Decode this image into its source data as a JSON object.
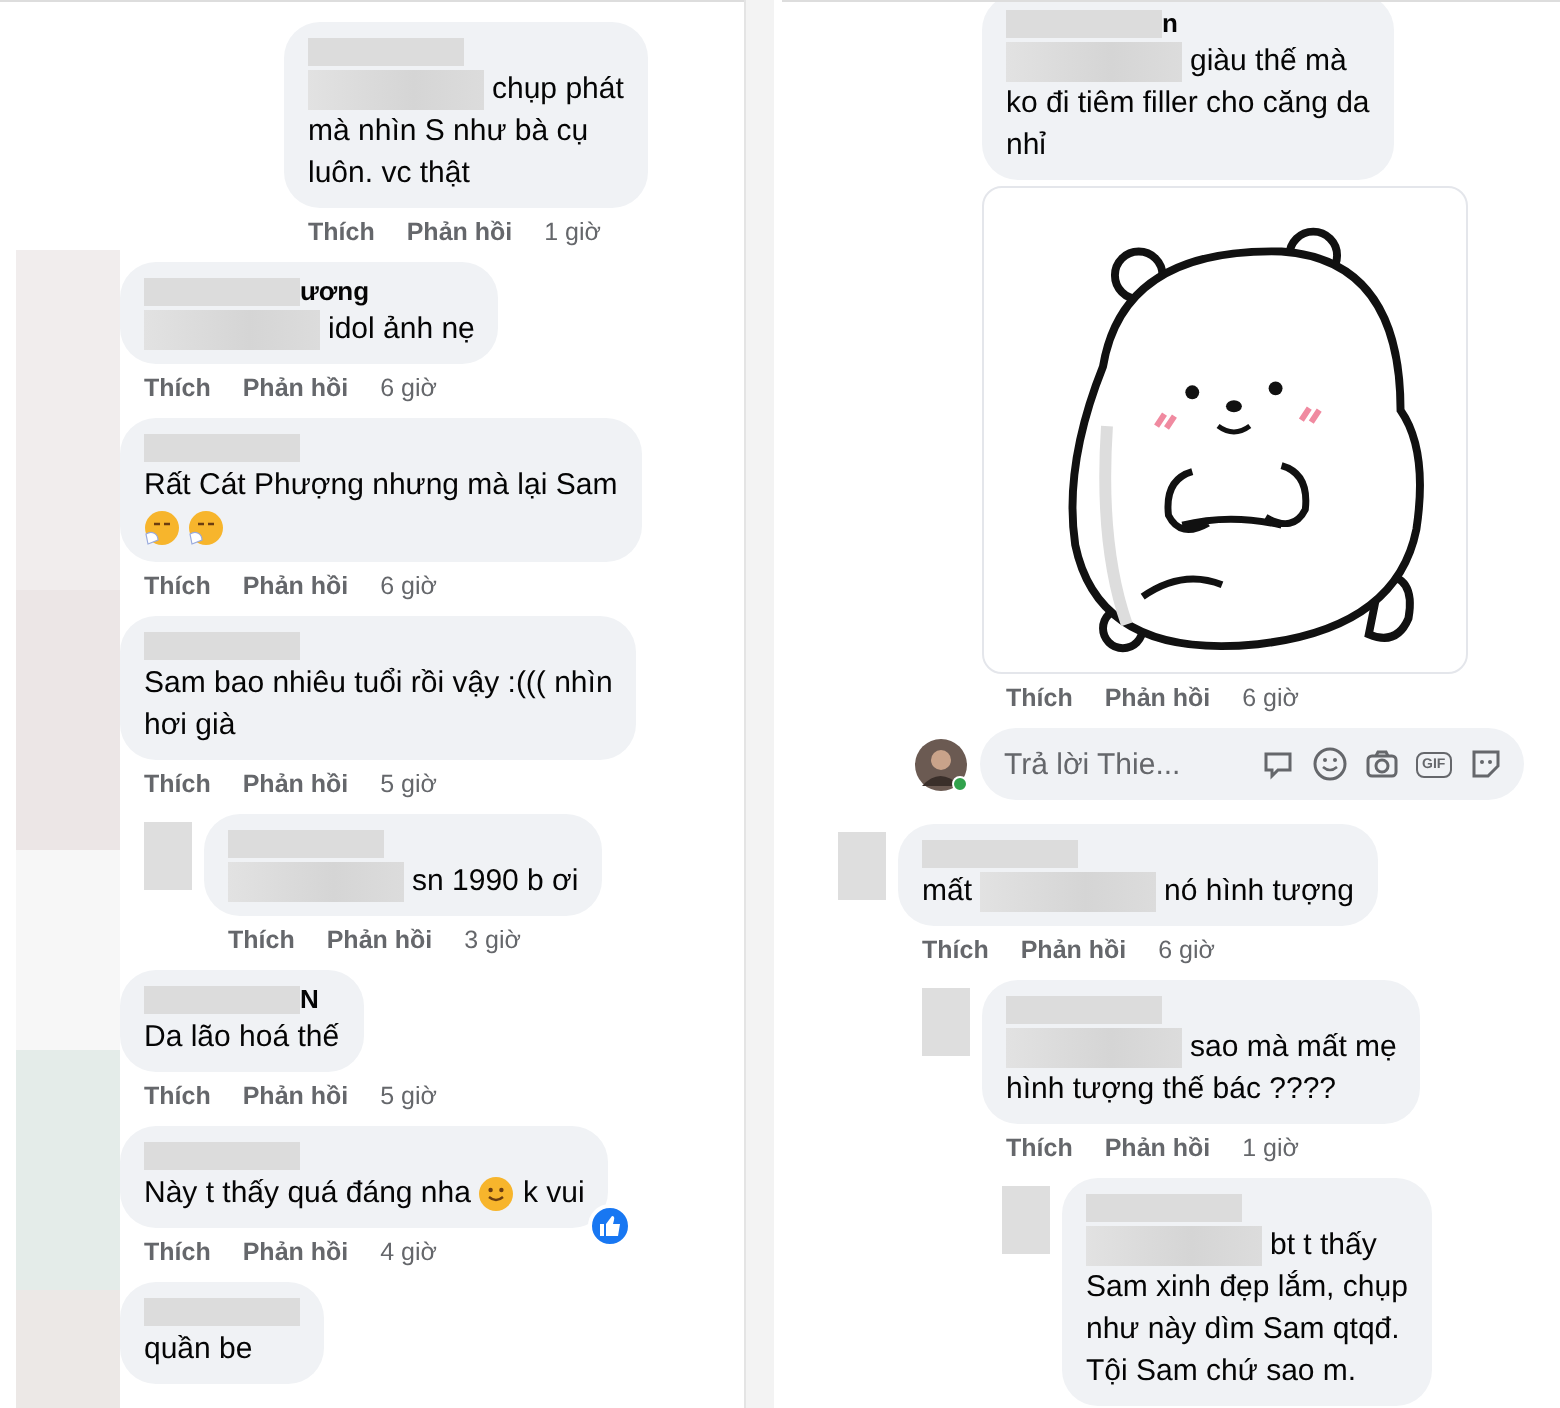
{
  "panels": [
    {
      "comments": [
        {
          "kind": "nested",
          "lines": [
            [
              {
                "kind": "redacted"
              },
              {
                "kind": "text",
                "text": "chụp phát"
              }
            ],
            [
              {
                "kind": "text",
                "text": "mà nhìn S như bà cụ"
              }
            ],
            [
              {
                "kind": "text",
                "text": "luôn. vc thật"
              }
            ]
          ],
          "actions": [
            "Thích",
            "Phản hồi",
            "1 giờ"
          ]
        },
        {
          "kind": "comment",
          "name": "ương",
          "lines": [
            [
              {
                "kind": "redacted"
              },
              {
                "kind": "text",
                "text": "idol ảnh nẹ"
              }
            ]
          ],
          "actions": [
            "Thích",
            "Phản hồi",
            "6 giờ"
          ]
        },
        {
          "kind": "comment",
          "lines": [
            [
              {
                "kind": "text",
                "text": "Rất Cát Phượng nhưng mà lại Sam"
              }
            ],
            [
              {
                "kind": "sneeze_emoji"
              },
              {
                "kind": "sneeze_emoji"
              }
            ]
          ],
          "actions": [
            "Thích",
            "Phản hồi",
            "6 giờ"
          ]
        },
        {
          "kind": "comment",
          "lines": [
            [
              {
                "kind": "text",
                "text": "Sam bao nhiêu tuổi rồi vậy :((( nhìn"
              }
            ],
            [
              {
                "kind": "text",
                "text": "hơi già"
              }
            ]
          ],
          "actions": [
            "Thích",
            "Phản hồi",
            "5 giờ"
          ]
        },
        {
          "kind": "reply",
          "avatar_redacted": true,
          "lines": [
            [
              {
                "kind": "redacted"
              },
              {
                "kind": "text",
                "text": "sn 1990 b ơi"
              }
            ]
          ],
          "actions": [
            "Thích",
            "Phản hồi",
            "3 giờ"
          ]
        },
        {
          "kind": "comment",
          "name": "N",
          "lines": [
            [
              {
                "kind": "text",
                "text": "Da lão hoá thế"
              }
            ]
          ],
          "actions": [
            "Thích",
            "Phản hồi",
            "5 giờ"
          ]
        },
        {
          "kind": "comment",
          "reaction": true,
          "lines": [
            [
              {
                "kind": "text",
                "text": "Này t thấy quá đáng nha"
              },
              {
                "kind": "smile_emoji"
              },
              {
                "kind": "text",
                "text": "k vui"
              }
            ]
          ],
          "actions": [
            "Thích",
            "Phản hồi",
            "4 giờ"
          ]
        },
        {
          "kind": "comment",
          "lines": [
            [
              {
                "kind": "text",
                "text": "quần be"
              }
            ]
          ]
        }
      ]
    },
    {
      "comments": [
        {
          "kind": "reply",
          "name": "n",
          "lines": [
            [
              {
                "kind": "redacted"
              },
              {
                "kind": "text",
                "text": "giàu thế mà"
              }
            ],
            [
              {
                "kind": "text",
                "text": "ko đi tiêm filler cho căng da"
              }
            ],
            [
              {
                "kind": "text",
                "text": "nhỉ"
              }
            ]
          ],
          "sticker": true,
          "actions": [
            "Thích",
            "Phản hồi",
            "6 giờ"
          ]
        },
        {
          "kind": "reply_box",
          "placeholder": "Trả lời Thie...",
          "gif_label": "GIF"
        },
        {
          "kind": "comment",
          "avatar_redacted": true,
          "lines": [
            [
              {
                "kind": "text",
                "text": "mất"
              },
              {
                "kind": "redacted"
              },
              {
                "kind": "text",
                "text": "nó hình tượng"
              }
            ]
          ],
          "actions": [
            "Thích",
            "Phản hồi",
            "6 giờ"
          ]
        },
        {
          "kind": "reply",
          "avatar_redacted": true,
          "lines": [
            [
              {
                "kind": "redacted"
              },
              {
                "kind": "text",
                "text": "sao mà mất mẹ"
              }
            ],
            [
              {
                "kind": "text",
                "text": "hình tượng thế bác ????"
              }
            ]
          ],
          "actions": [
            "Thích",
            "Phản hồi",
            "1 giờ"
          ]
        },
        {
          "kind": "nested",
          "avatar_redacted": true,
          "lines": [
            [
              {
                "kind": "redacted"
              },
              {
                "kind": "text",
                "text": "bt t thấy"
              }
            ],
            [
              {
                "kind": "text",
                "text": "Sam xinh đẹp lắm, chụp"
              }
            ],
            [
              {
                "kind": "text",
                "text": "như này dìm Sam qtqđ."
              }
            ],
            [
              {
                "kind": "text",
                "text": "Tội Sam chứ sao m."
              }
            ]
          ]
        }
      ]
    }
  ]
}
